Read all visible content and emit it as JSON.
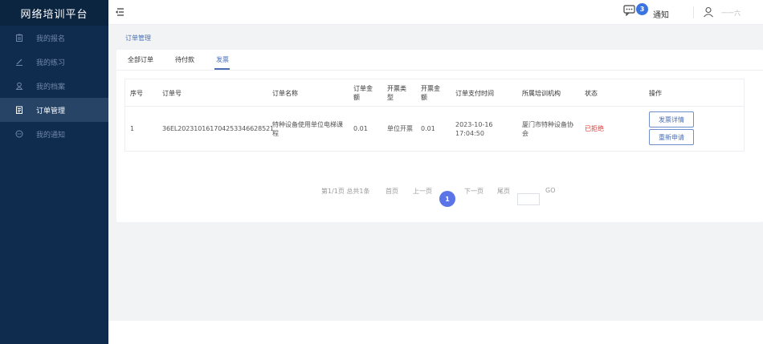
{
  "app": {
    "title": "网络培训平台"
  },
  "sidebar": {
    "items": [
      {
        "label": "我的报名",
        "icon": "clipboard-icon"
      },
      {
        "label": "我的练习",
        "icon": "pencil-icon"
      },
      {
        "label": "我的档案",
        "icon": "user-profile-icon"
      },
      {
        "label": "订单管理",
        "icon": "order-icon",
        "active": true
      },
      {
        "label": "我的通知",
        "icon": "message-icon"
      }
    ]
  },
  "topbar": {
    "notice_label": "通知",
    "notice_count": "3",
    "user_name": "一一六"
  },
  "breadcrumb": "订单管理",
  "tabs": [
    {
      "label": "全部订单"
    },
    {
      "label": "待付款"
    },
    {
      "label": "发票",
      "active": true
    }
  ],
  "table": {
    "headers": [
      "序号",
      "订单号",
      "订单名称",
      "订单金额",
      "开票类型",
      "开票金额",
      "订单支付时间",
      "所属培训机构",
      "状态",
      "操作"
    ],
    "header_lines": {
      "amount": [
        "订单金",
        "额"
      ],
      "invoice_type": [
        "开票类",
        "型"
      ],
      "invoice_amount": [
        "开票金",
        "额"
      ]
    },
    "rows": [
      {
        "index": "1",
        "order_no": "36EL20231016170425334662852​1",
        "order_name": [
          "特种设备使用单位电梯课",
          "程"
        ],
        "amount": "0.01",
        "invoice_type": "单位开票",
        "invoice_amount": "0.01",
        "pay_date": "2023-10-16",
        "pay_time": "17:04:50",
        "org": [
          "厦门市特种设备协",
          "会"
        ],
        "status": "已拒绝",
        "actions": [
          "发票详情",
          "重新申请"
        ]
      }
    ]
  },
  "pagination": {
    "summary": "第1/1页 总共1条",
    "first": "首页",
    "prev": "上一页",
    "current": "1",
    "next": "下一页",
    "last": "尾页",
    "go": "GO"
  },
  "colors": {
    "sidebar": "#0f2c4f",
    "accent": "#4a6fb8",
    "badge": "#3a74e0",
    "danger": "#e53935"
  }
}
